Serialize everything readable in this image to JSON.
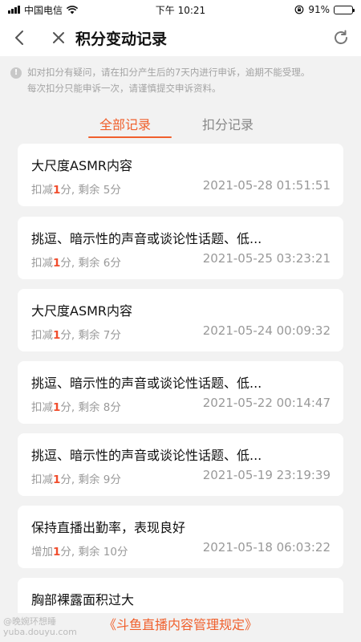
{
  "status_bar": {
    "carrier": "中国电信",
    "time": "下午 10:21",
    "battery": "91%",
    "battery_level": 0.91
  },
  "nav": {
    "title": "积分变动记录",
    "icons": [
      "chevron-left-icon",
      "close-icon",
      "refresh-icon"
    ]
  },
  "notice": {
    "icon": "info-icon",
    "line1": "如对扣分有疑问，请在扣分产生后的7天内进行申诉，逾期不能受理。",
    "line2": "每次扣分只能申诉一次，请谨慎提交申诉资料。"
  },
  "tabs": [
    {
      "label": "全部记录",
      "active": true
    },
    {
      "label": "扣分记录",
      "active": false
    }
  ],
  "records": [
    {
      "title": "大尺度ASMR内容",
      "prefix": "扣减",
      "amount": "1",
      "suffix": "分, 剩余 5分",
      "time": "2021-05-28 01:51:51"
    },
    {
      "title": "挑逗、暗示性的声音或谈论性话题、低...",
      "prefix": "扣减",
      "amount": "1",
      "suffix": "分, 剩余 6分",
      "time": "2021-05-25 03:23:21"
    },
    {
      "title": "大尺度ASMR内容",
      "prefix": "扣减",
      "amount": "1",
      "suffix": "分, 剩余 7分",
      "time": "2021-05-24 00:09:32"
    },
    {
      "title": "挑逗、暗示性的声音或谈论性话题、低...",
      "prefix": "扣减",
      "amount": "1",
      "suffix": "分, 剩余 8分",
      "time": "2021-05-22 00:14:47"
    },
    {
      "title": "挑逗、暗示性的声音或谈论性话题、低...",
      "prefix": "扣减",
      "amount": "1",
      "suffix": "分, 剩余 9分",
      "time": "2021-05-19 23:19:39"
    },
    {
      "title": "保持直播出勤率，表现良好",
      "prefix": "增加",
      "amount": "1",
      "suffix": "分, 剩余 10分",
      "time": "2021-05-18 06:03:22"
    },
    {
      "title": "胸部裸露面积过大",
      "prefix": "",
      "amount": "",
      "suffix": "",
      "time": ""
    }
  ],
  "footer": {
    "link": "《斗鱼直播内容管理规定》"
  },
  "watermark": {
    "line1": "@晚婉环想睡",
    "line2": "yuba.douyu.com"
  },
  "colors": {
    "accent": "#f0602d",
    "deduct": "#f04d2d",
    "background": "#f2f2f2",
    "muted": "#999999"
  }
}
